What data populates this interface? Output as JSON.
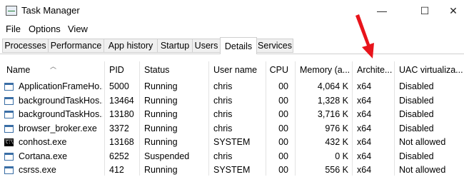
{
  "window": {
    "title": "Task Manager",
    "controls": {
      "minimize": "—",
      "maximize": "☐",
      "close": "✕"
    }
  },
  "menu": [
    "File",
    "Options",
    "View"
  ],
  "tabs": [
    "Processes",
    "Performance",
    "App history",
    "Startup",
    "Users",
    "Details",
    "Services"
  ],
  "active_tab": "Details",
  "columns": [
    "Name",
    "PID",
    "Status",
    "User name",
    "CPU",
    "Memory (a...",
    "Archite...",
    "UAC virtualiza..."
  ],
  "rows": [
    {
      "icon": "window-icon",
      "name": "ApplicationFrameHo...",
      "pid": "5000",
      "status": "Running",
      "user": "chris",
      "cpu": "00",
      "memory": "4,064 K",
      "arch": "x64",
      "uac": "Disabled"
    },
    {
      "icon": "window-icon",
      "name": "backgroundTaskHos...",
      "pid": "13464",
      "status": "Running",
      "user": "chris",
      "cpu": "00",
      "memory": "1,328 K",
      "arch": "x64",
      "uac": "Disabled"
    },
    {
      "icon": "window-icon",
      "name": "backgroundTaskHos...",
      "pid": "13180",
      "status": "Running",
      "user": "chris",
      "cpu": "00",
      "memory": "3,716 K",
      "arch": "x64",
      "uac": "Disabled"
    },
    {
      "icon": "window-icon",
      "name": "browser_broker.exe",
      "pid": "3372",
      "status": "Running",
      "user": "chris",
      "cpu": "00",
      "memory": "976 K",
      "arch": "x64",
      "uac": "Disabled"
    },
    {
      "icon": "console-icon",
      "name": "conhost.exe",
      "pid": "13168",
      "status": "Running",
      "user": "SYSTEM",
      "cpu": "00",
      "memory": "432 K",
      "arch": "x64",
      "uac": "Not allowed"
    },
    {
      "icon": "window-icon",
      "name": "Cortana.exe",
      "pid": "6252",
      "status": "Suspended",
      "user": "chris",
      "cpu": "00",
      "memory": "0 K",
      "arch": "x64",
      "uac": "Disabled"
    },
    {
      "icon": "window-icon",
      "name": "csrss.exe",
      "pid": "412",
      "status": "Running",
      "user": "SYSTEM",
      "cpu": "00",
      "memory": "556 K",
      "arch": "x64",
      "uac": "Not allowed"
    }
  ],
  "callout_color": "#e8141b"
}
